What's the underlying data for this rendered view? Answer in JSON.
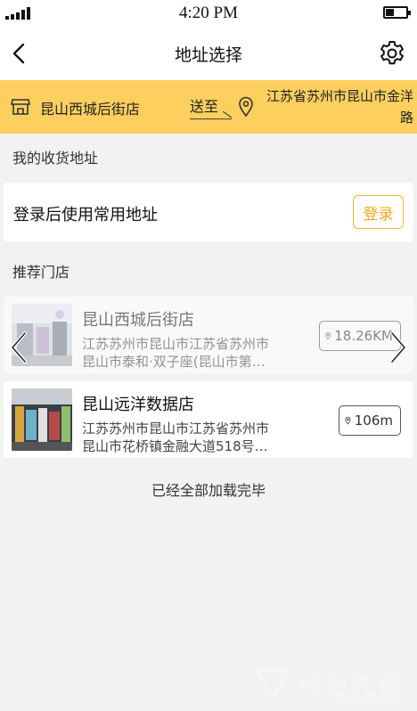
{
  "status_bar": {
    "time": "4:20 PM",
    "signal_bars": 5,
    "battery_level": 0.4
  },
  "nav": {
    "title": "地址选择",
    "back_icon": "chevron-left-icon",
    "settings_icon": "gear-icon"
  },
  "delivery": {
    "store_name": "昆山西城后街店",
    "send_to_label": "送至",
    "address": "江苏省苏州市昆山市金洋路",
    "store_icon": "store-icon",
    "pin_icon": "location-pin-icon"
  },
  "sections": {
    "my_address": "我的收货地址",
    "recommended_stores": "推荐门店"
  },
  "login_card": {
    "text": "登录后使用常用地址",
    "button": "登录"
  },
  "stores": [
    {
      "name": "昆山西城后街店",
      "address": "江苏苏州市昆山市江苏省苏州市\n昆山市泰和·双子座(昆山市第…",
      "distance": "18.26KM",
      "state": "dimmed"
    },
    {
      "name": "昆山远洋数据店",
      "address": "江苏苏州市昆山市江苏省苏州市\n昆山市花桥镇金融大道518号…",
      "distance": "106m",
      "state": "normal"
    }
  ],
  "footer_text": "已经全部加载完毕",
  "watermark": {
    "text": "绿色先锋",
    "url": "www.greenxf.com"
  },
  "colors": {
    "accent": "#fccf5f",
    "login_border": "#f0b72f",
    "background": "#f2f2f2"
  }
}
